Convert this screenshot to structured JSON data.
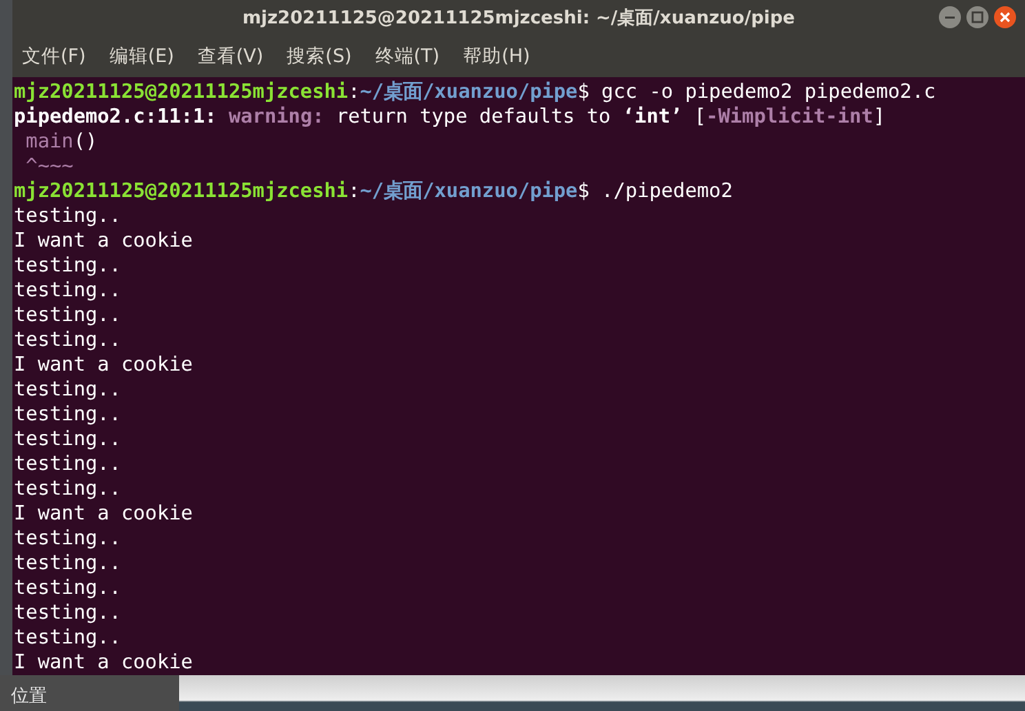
{
  "window": {
    "title": "mjz20211125@20211125mjzceshi: ~/桌面/xuanzuo/pipe"
  },
  "menu": [
    "文件(F)",
    "编辑(E)",
    "查看(V)",
    "搜索(S)",
    "终端(T)",
    "帮助(H)"
  ],
  "terminal": {
    "lines": [
      [
        {
          "kind": "user",
          "text": "mjz20211125@20211125mjzceshi"
        },
        {
          "kind": "plain",
          "text": ":"
        },
        {
          "kind": "path",
          "text": "~/桌面/xuanzuo/pipe"
        },
        {
          "kind": "plain",
          "text": "$ gcc -o pipedemo2 pipedemo2.c"
        }
      ],
      [
        {
          "kind": "bold",
          "text": "pipedemo2.c:11:1:"
        },
        {
          "kind": "warning",
          "text": " warning:"
        },
        {
          "kind": "plain",
          "text": " return type defaults to "
        },
        {
          "kind": "bold",
          "text": "‘int’"
        },
        {
          "kind": "plain",
          "text": " ["
        },
        {
          "kind": "warning",
          "text": "-Wimplicit-int"
        },
        {
          "kind": "plain",
          "text": "]"
        }
      ],
      [
        {
          "kind": "code",
          "text": " main"
        },
        {
          "kind": "plain",
          "text": "()"
        }
      ],
      [
        {
          "kind": "code",
          "text": " ^~~~"
        }
      ],
      [
        {
          "kind": "user",
          "text": "mjz20211125@20211125mjzceshi"
        },
        {
          "kind": "plain",
          "text": ":"
        },
        {
          "kind": "path",
          "text": "~/桌面/xuanzuo/pipe"
        },
        {
          "kind": "plain",
          "text": "$ ./pipedemo2"
        }
      ],
      [
        {
          "kind": "plain",
          "text": "testing.."
        }
      ],
      [
        {
          "kind": "plain",
          "text": "I want a cookie"
        }
      ],
      [
        {
          "kind": "plain",
          "text": "testing.."
        }
      ],
      [
        {
          "kind": "plain",
          "text": "testing.."
        }
      ],
      [
        {
          "kind": "plain",
          "text": "testing.."
        }
      ],
      [
        {
          "kind": "plain",
          "text": "testing.."
        }
      ],
      [
        {
          "kind": "plain",
          "text": "I want a cookie"
        }
      ],
      [
        {
          "kind": "plain",
          "text": "testing.."
        }
      ],
      [
        {
          "kind": "plain",
          "text": "testing.."
        }
      ],
      [
        {
          "kind": "plain",
          "text": "testing.."
        }
      ],
      [
        {
          "kind": "plain",
          "text": "testing.."
        }
      ],
      [
        {
          "kind": "plain",
          "text": "testing.."
        }
      ],
      [
        {
          "kind": "plain",
          "text": "I want a cookie"
        }
      ],
      [
        {
          "kind": "plain",
          "text": "testing.."
        }
      ],
      [
        {
          "kind": "plain",
          "text": "testing.."
        }
      ],
      [
        {
          "kind": "plain",
          "text": "testing.."
        }
      ],
      [
        {
          "kind": "plain",
          "text": "testing.."
        }
      ],
      [
        {
          "kind": "plain",
          "text": "testing.."
        }
      ],
      [
        {
          "kind": "plain",
          "text": "I want a cookie"
        }
      ]
    ]
  },
  "desktop": {
    "label": "位置"
  }
}
